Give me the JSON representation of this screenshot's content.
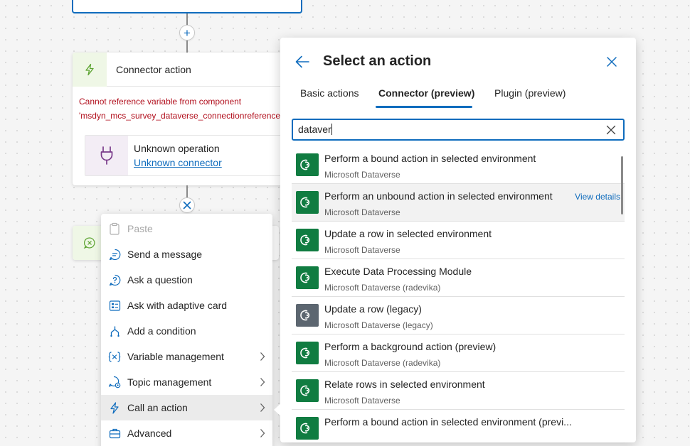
{
  "canvas": {
    "add_node_symbol": "+",
    "remove_node_symbol": "×",
    "connector_card": {
      "title": "Connector action",
      "error_line1": "Cannot reference variable from component",
      "error_line2": "'msdyn_mcs_survey_dataverse_connectionreference'",
      "operation_label": "Unknown operation",
      "connector_link": "Unknown connector",
      "icon": "lightning-icon",
      "accent_color": "#eff7e6"
    }
  },
  "context_menu": {
    "items": [
      {
        "label": "Paste",
        "icon": "paste-icon",
        "disabled": true
      },
      {
        "label": "Send a message",
        "icon": "chat-icon"
      },
      {
        "label": "Ask a question",
        "icon": "question-icon"
      },
      {
        "label": "Ask with adaptive card",
        "icon": "adaptive-card-icon"
      },
      {
        "label": "Add a condition",
        "icon": "branch-icon"
      },
      {
        "label": "Variable management",
        "icon": "variable-icon",
        "submenu": true
      },
      {
        "label": "Topic management",
        "icon": "topic-icon",
        "submenu": true
      },
      {
        "label": "Call an action",
        "icon": "lightning-icon",
        "submenu": true,
        "active": true
      },
      {
        "label": "Advanced",
        "icon": "toolbox-icon",
        "submenu": true
      }
    ]
  },
  "panel": {
    "title": "Select an action",
    "tabs": [
      {
        "label": "Basic actions"
      },
      {
        "label": "Connector (preview)",
        "active": true
      },
      {
        "label": "Plugin (preview)"
      }
    ],
    "search": {
      "value": "dataver"
    },
    "view_details_label": "View details",
    "results": [
      {
        "title": "Perform a bound action in selected environment",
        "subtitle": "Microsoft Dataverse",
        "icon_color": "#107c41"
      },
      {
        "title": "Perform an unbound action in selected environment",
        "subtitle": "Microsoft Dataverse",
        "icon_color": "#107c41"
      },
      {
        "title": "Update a row in selected environment",
        "subtitle": "Microsoft Dataverse",
        "icon_color": "#107c41"
      },
      {
        "title": "Execute Data Processing Module",
        "subtitle": "Microsoft Dataverse (radevika)",
        "icon_color": "#107c41"
      },
      {
        "title": "Update a row (legacy)",
        "subtitle": "Microsoft Dataverse (legacy)",
        "icon_color": "#5c6670"
      },
      {
        "title": "Perform a background action (preview)",
        "subtitle": "Microsoft Dataverse (radevika)",
        "icon_color": "#107c41"
      },
      {
        "title": "Relate rows in selected environment",
        "subtitle": "Microsoft Dataverse",
        "icon_color": "#107c41"
      },
      {
        "title": "Perform a bound action in selected environment (previ...",
        "subtitle": "",
        "icon_color": "#107c41"
      }
    ],
    "hovered_result_index": 1,
    "accent_color": "#0f6cbd"
  }
}
